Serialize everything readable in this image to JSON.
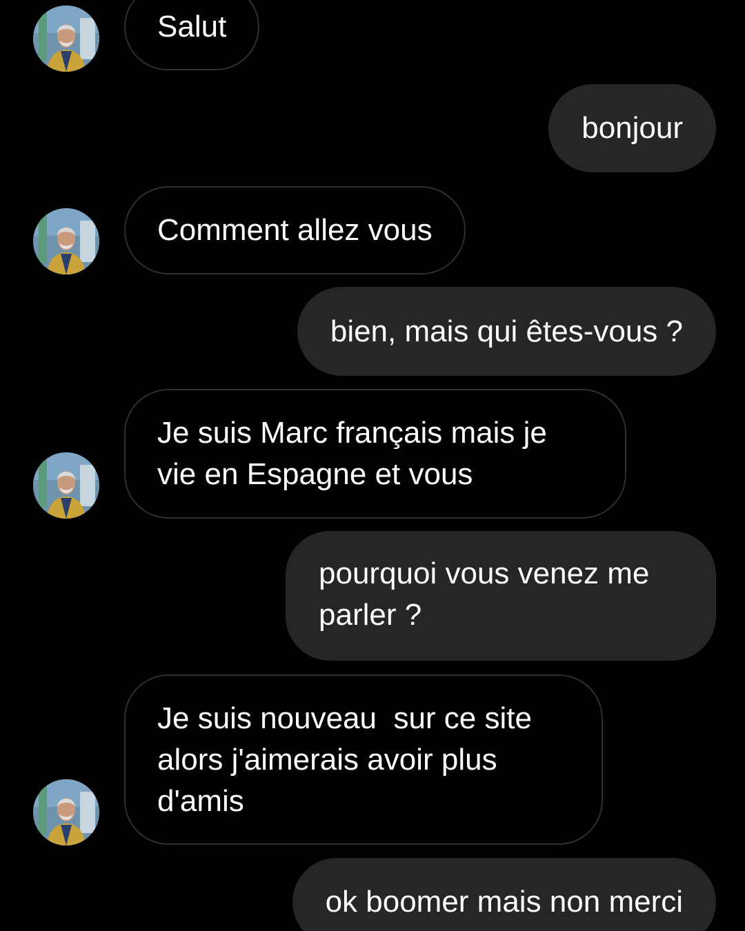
{
  "conversation": {
    "messages": [
      {
        "direction": "received",
        "text": "Salut"
      },
      {
        "direction": "sent",
        "text": "bonjour"
      },
      {
        "direction": "received",
        "text": "Comment allez vous"
      },
      {
        "direction": "sent",
        "text": "bien, mais qui êtes-vous ?"
      },
      {
        "direction": "received",
        "text": "Je suis Marc français mais je\nvie en Espagne et vous"
      },
      {
        "direction": "sent",
        "text": "pourquoi vous venez me\nparler ?"
      },
      {
        "direction": "received",
        "text": "Je suis nouveau  sur ce site\nalors j'aimerais avoir plus\nd'amis"
      },
      {
        "direction": "sent",
        "text": "ok boomer mais non merci"
      }
    ]
  },
  "colors": {
    "background": "#000000",
    "sent_bubble": "#262626",
    "received_border": "#2f2f2f",
    "text": "#ffffff"
  },
  "icons": {
    "avatar": "contact-profile-photo"
  }
}
